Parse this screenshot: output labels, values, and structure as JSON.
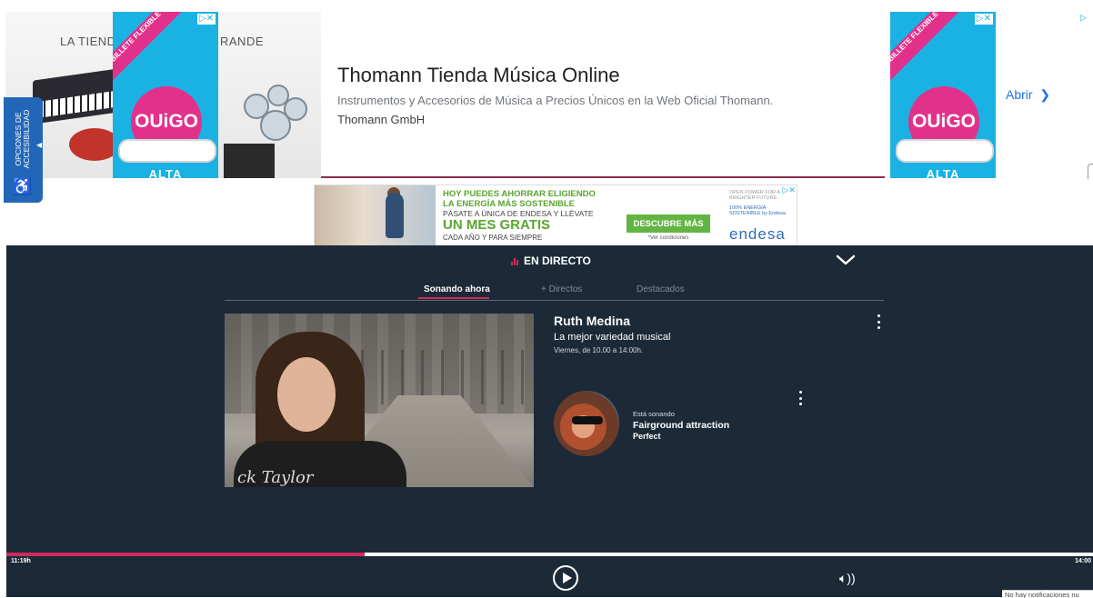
{
  "top_ad": {
    "left_image": {
      "text_left": "LA TIEND",
      "text_right": "RANDE"
    },
    "ouigo": {
      "band": "BILLETE FLEXIBLE",
      "brand": "OUiGO",
      "footer": "ALTA",
      "adchoice": "▷✕"
    },
    "title": "Thomann Tienda Música Online",
    "description": "Instrumentos y Accesorios de Música a Precios Únicos en la Web Oficial Thomann.",
    "advertiser": "Thomann GmbH",
    "cta": "Abrir",
    "right_adchoice": "▷"
  },
  "accessibility": {
    "label": "OPCIONES DE ACCESIBILIDAD",
    "symbol": "♿"
  },
  "banner_ad": {
    "line1": "HOY PUEDES AHORRAR ELIGIENDO",
    "line2": "LA ENERGÍA MÁS SOSTENIBLE",
    "line3": "PÁSATE A ÚNICA DE ENDESA Y LLÉVATE",
    "line4": "UN MES GRATIS",
    "line5": "CADA AÑO Y PARA SIEMPRE",
    "button": "DESCUBRE MÁS",
    "conditions": "*Ver condiciones",
    "tagline": "OPEN POWER FOR A BRIGHTER FUTURE.",
    "claim": "100% ENERGÍA SOSTENIBLE by Endesa",
    "logo": "endesa",
    "adchoice": "▷✕"
  },
  "player": {
    "live_label": "EN DIRECTO",
    "tabs": [
      {
        "label": "Sonando ahora",
        "active": true
      },
      {
        "label": "+ Directos",
        "active": false
      },
      {
        "label": "Destacados",
        "active": false
      }
    ],
    "show": {
      "host": "Ruth Medina",
      "subtitle": "La mejor variedad musical",
      "schedule": "Viernes, de 10.00 a 14:00h.",
      "shirt_text": "ck Taylor"
    },
    "now_playing": {
      "label": "Está sonando",
      "artist": "Fairground attraction",
      "song": "Perfect"
    },
    "time_start": "11:19h",
    "time_end": "14:00",
    "progress_fraction": 0.33,
    "volume_icon": "🔈︎))",
    "accent": "#d02b5a",
    "background": "#1c2a38"
  },
  "notification": "No hay notificaciones nu"
}
